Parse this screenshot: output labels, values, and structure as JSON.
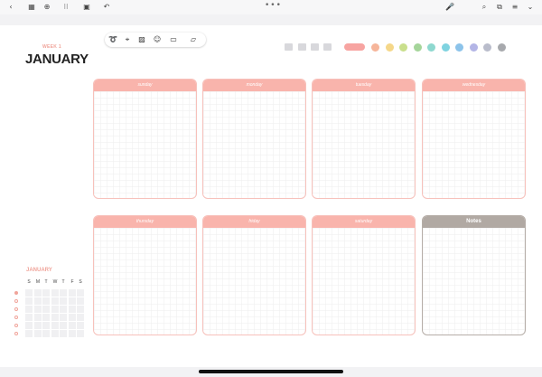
{
  "topbar": {
    "back_icon": "‹",
    "grid_icon": "▦",
    "add_page_icon": "⊕",
    "apps_icon": "⁝⁝",
    "present_icon": "▣",
    "undo_icon": "↶",
    "more_dots": "•••",
    "mic_icon": "🎤",
    "search_icon": "⌕",
    "share_icon": "⧉",
    "edit_icon": "≡",
    "chevron_icon": "⌄"
  },
  "header": {
    "week_label": "WEEK 1",
    "month_title": "JANUARY"
  },
  "toolbar": {
    "lasso_icon": "➰",
    "pointer_icon": "⌖",
    "image_icon": "▨",
    "sticker_icon": "☺",
    "comment_icon": "▭",
    "note_icon": "▱"
  },
  "palette": {
    "accent": "#f7a4a1",
    "colors": [
      "#f6b59a",
      "#f5d789",
      "#c9df8c",
      "#a5d59a",
      "#8ed8cf",
      "#7fd3e0",
      "#8cc3ea",
      "#b3b5e6",
      "#b9bccb",
      "#a7a9ad"
    ]
  },
  "days": [
    {
      "label": "sunday"
    },
    {
      "label": "monday"
    },
    {
      "label": "tuesday"
    },
    {
      "label": "wednesday"
    },
    {
      "label": "thursday"
    },
    {
      "label": "friday"
    },
    {
      "label": "saturday"
    }
  ],
  "notes": {
    "label": "Notes"
  },
  "mini_calendar": {
    "title": "JANUARY",
    "weekdays": [
      "S",
      "M",
      "T",
      "W",
      "T",
      "F",
      "S"
    ]
  }
}
